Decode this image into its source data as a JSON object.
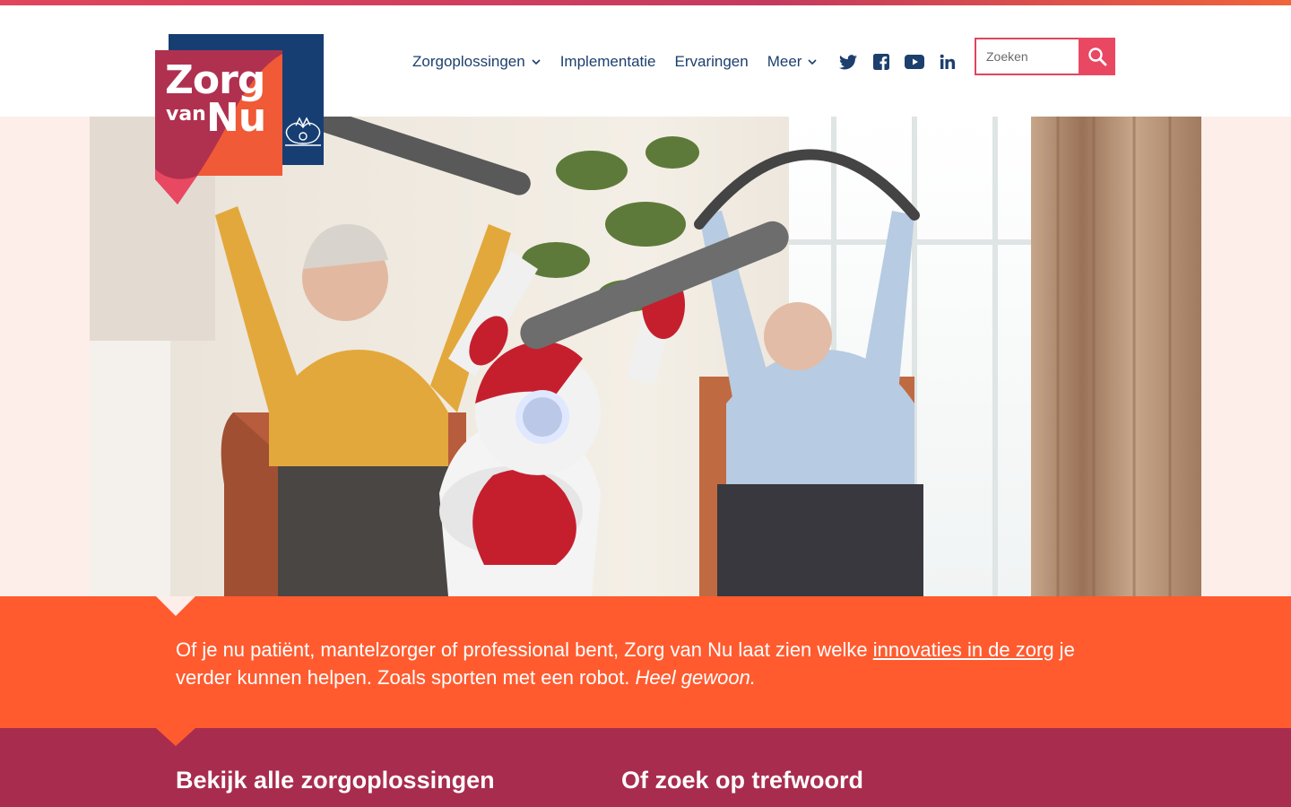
{
  "header": {
    "logo": {
      "line1": "Zorg",
      "line2": "van",
      "line3": "Nu"
    },
    "nav": [
      {
        "label": "Zorgoplossingen",
        "has_dropdown": true
      },
      {
        "label": "Implementatie",
        "has_dropdown": false
      },
      {
        "label": "Ervaringen",
        "has_dropdown": false
      },
      {
        "label": "Meer",
        "has_dropdown": true
      }
    ],
    "social": [
      "twitter-icon",
      "facebook-icon",
      "youtube-icon",
      "linkedin-icon"
    ],
    "search": {
      "placeholder": "Zoeken",
      "value": ""
    }
  },
  "intro": {
    "text_before_link": "Of je nu patiënt, mantelzorger of professional bent, Zorg van Nu laat zien welke ",
    "link_text": "innovaties in de zorg",
    "text_after_link": " je verder kunnen helpen. Zoals sporten met een robot. ",
    "emphasis": "Heel gewoon."
  },
  "browse": {
    "left_heading": "Bekijk alle zorgoplossingen",
    "right_heading": "Of zoek op trefwoord"
  },
  "colors": {
    "navy": "#1d3f6e",
    "pink": "#e94862",
    "orange": "#ff5b2f",
    "berry": "#a82c4e",
    "hero_bg": "#fdeeea"
  }
}
